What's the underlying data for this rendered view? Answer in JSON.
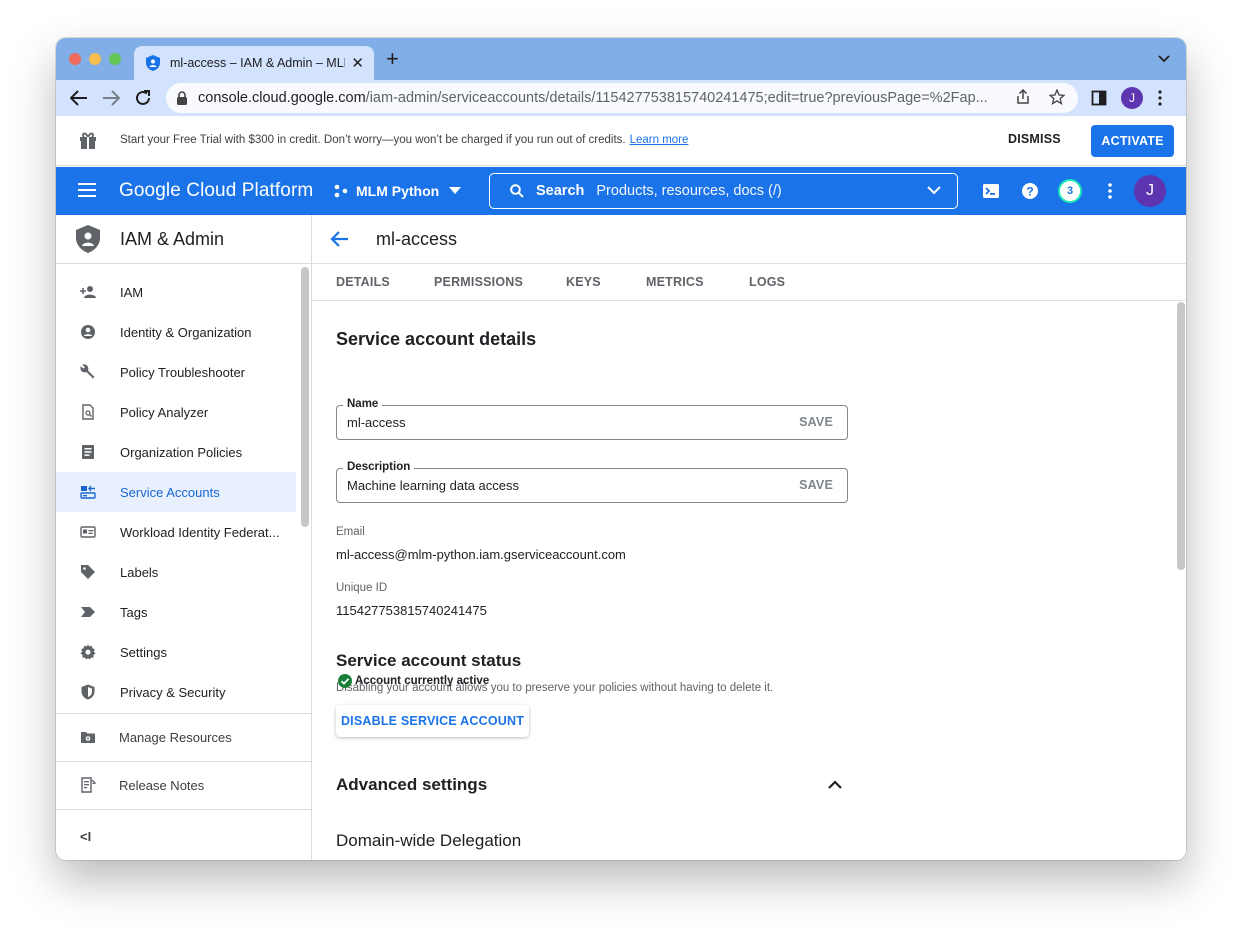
{
  "browser": {
    "tab_title": "ml-access – IAM & Admin – MLM Python – Google Cloud",
    "tab_close": "✕",
    "new_tab": "+",
    "url_host": "console.cloud.google.com",
    "url_path": "/iam-admin/serviceaccounts/details/115427753815740241475;edit=true?previousPage=%2Fap...",
    "profile_initial": "J"
  },
  "banner": {
    "message": "Start your Free Trial with $300 in credit. Don’t worry—you won’t be charged if you run out of credits.",
    "learn_more": "Learn more",
    "dismiss": "DISMISS",
    "activate": "ACTIVATE"
  },
  "header": {
    "brand": "Google Cloud Platform",
    "project": "MLM Python",
    "search_label": "Search",
    "search_placeholder": "Products, resources, docs (/)",
    "notifications_count": "3",
    "avatar_initial": "J",
    "accent": "#1a73e8"
  },
  "sidebar": {
    "title": "IAM & Admin",
    "items": [
      {
        "label": "IAM",
        "icon": "person-add-icon"
      },
      {
        "label": "Identity & Organization",
        "icon": "account-circle-icon"
      },
      {
        "label": "Policy Troubleshooter",
        "icon": "wrench-icon"
      },
      {
        "label": "Policy Analyzer",
        "icon": "document-search-icon"
      },
      {
        "label": "Organization Policies",
        "icon": "list-document-icon"
      },
      {
        "label": "Service Accounts",
        "icon": "service-account-icon",
        "active": true
      },
      {
        "label": "Workload Identity Federat...",
        "icon": "id-card-icon"
      },
      {
        "label": "Labels",
        "icon": "label-tag-icon"
      },
      {
        "label": "Tags",
        "icon": "tag-arrow-icon"
      },
      {
        "label": "Settings",
        "icon": "gear-icon"
      },
      {
        "label": "Privacy & Security",
        "icon": "shield-icon"
      }
    ],
    "manage_resources": "Manage Resources",
    "release_notes": "Release Notes",
    "collapse": "<I"
  },
  "main": {
    "title": "ml-access",
    "tabs": [
      "DETAILS",
      "PERMISSIONS",
      "KEYS",
      "METRICS",
      "LOGS"
    ],
    "details_heading": "Service account details",
    "name_label": "Name",
    "name_value": "ml-access",
    "description_label": "Description",
    "description_value": "Machine learning data access",
    "save_label": "SAVE",
    "email_label": "Email",
    "email_value": "ml-access@mlm-python.iam.gserviceaccount.com",
    "uid_label": "Unique ID",
    "uid_value": "115427753815740241475",
    "status_heading": "Service account status",
    "status_description": "Disabling your account allows you to preserve your policies without having to delete it.",
    "status_value": "Account currently active",
    "disable_button": "DISABLE SERVICE ACCOUNT",
    "advanced_heading": "Advanced settings",
    "delegation_heading": "Domain-wide Delegation"
  }
}
